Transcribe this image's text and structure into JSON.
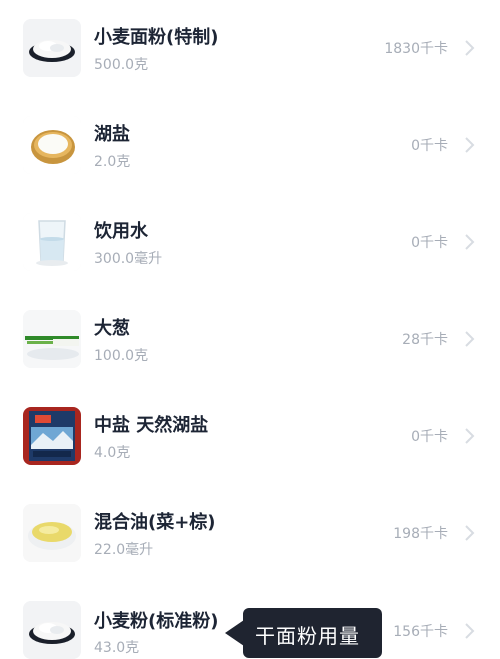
{
  "ingredients": [
    {
      "name": "小麦面粉(特制)",
      "amount": "500.0克",
      "calories": "1830千卡",
      "icon": "flour-icon"
    },
    {
      "name": "湖盐",
      "amount": "2.0克",
      "calories": "0千卡",
      "icon": "salt-bowl-icon"
    },
    {
      "name": "饮用水",
      "amount": "300.0毫升",
      "calories": "0千卡",
      "icon": "water-glass-icon"
    },
    {
      "name": "大葱",
      "amount": "100.0克",
      "calories": "28千卡",
      "icon": "scallion-icon"
    },
    {
      "name": "中盐 天然湖盐",
      "amount": "4.0克",
      "calories": "0千卡",
      "icon": "salt-package-icon"
    },
    {
      "name": "混合油(菜+棕)",
      "amount": "22.0毫升",
      "calories": "198千卡",
      "icon": "oil-bowl-icon"
    },
    {
      "name": "小麦粉(标准粉)",
      "amount": "43.0克",
      "calories": "156千卡",
      "icon": "flour-icon"
    }
  ],
  "tooltip": {
    "text": "干面粉用量"
  },
  "colors": {
    "name_text": "#1d2535",
    "secondary_text": "#a7adb7",
    "tooltip_bg": "#1f2430",
    "chevron": "#d8dce2"
  },
  "icons": {
    "row_action": "chevron-right-icon"
  }
}
